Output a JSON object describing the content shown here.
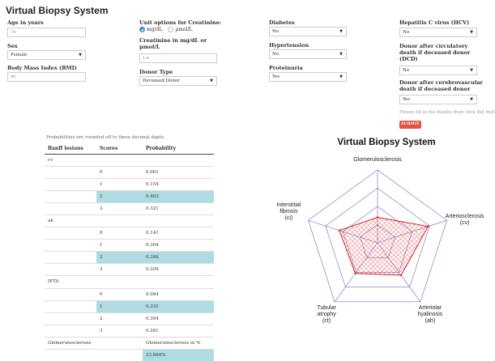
{
  "app": {
    "title": "Virtual Biopsy System"
  },
  "form": {
    "age": {
      "label": "Age in years",
      "value": "78"
    },
    "sex": {
      "label": "Sex",
      "value": "Female"
    },
    "bmi": {
      "label": "Body Mass Index (BMI)",
      "value": "40"
    },
    "creatinine_units": {
      "label": "Unit options for Creatinine:",
      "options": [
        "mg/dL",
        "µmol/L"
      ],
      "selected": "mg/dL"
    },
    "creatinine": {
      "label": "Creatinine in mg/dL or µmol/L",
      "value": "1.4"
    },
    "donor_type": {
      "label": "Donor Type",
      "value": "Deceased Donor"
    },
    "diabetes": {
      "label": "Diabetes",
      "value": "No"
    },
    "hypertension": {
      "label": "Hypertension",
      "value": "No"
    },
    "proteinuria": {
      "label": "Proteinuria",
      "value": "Yes"
    },
    "hcv": {
      "label": "Hepatitis C virus (HCV)",
      "value": "No"
    },
    "dcd": {
      "label": "Donor after circulatory death if deceased donor (DCD)",
      "value": "No"
    },
    "cerebro": {
      "label": "Donor after cerebrovascular death if deceased donor",
      "value": "Yes"
    },
    "hint": "Please fill in the blanks then click the butto",
    "submit_label": "SUBMIT"
  },
  "table": {
    "note": "Probabilities are rounded off to three decimal digits.",
    "headers": [
      "Banff lesions",
      "Scores",
      "Probability"
    ],
    "rows": [
      {
        "lesion": "cv",
        "score": "",
        "prob": "",
        "hl": false
      },
      {
        "lesion": "",
        "score": "0",
        "prob": "0.061",
        "hl": false
      },
      {
        "lesion": "",
        "score": "1",
        "prob": "0.154",
        "hl": false
      },
      {
        "lesion": "",
        "score": "2",
        "prob": "0.463",
        "hl": true
      },
      {
        "lesion": "",
        "score": "3",
        "prob": "0.321",
        "hl": false
      },
      {
        "lesion": "ah",
        "score": "",
        "prob": "",
        "hl": false
      },
      {
        "lesion": "",
        "score": "0",
        "prob": "0.141",
        "hl": false
      },
      {
        "lesion": "",
        "score": "1",
        "prob": "0.304",
        "hl": false
      },
      {
        "lesion": "",
        "score": "2",
        "prob": "0.346",
        "hl": true
      },
      {
        "lesion": "",
        "score": "3",
        "prob": "0.209",
        "hl": false
      },
      {
        "lesion": "IFTA",
        "score": "",
        "prob": "",
        "hl": false
      },
      {
        "lesion": "",
        "score": "0",
        "prob": "0.084",
        "hl": false
      },
      {
        "lesion": "",
        "score": "1",
        "prob": "0.331",
        "hl": true
      },
      {
        "lesion": "",
        "score": "2",
        "prob": "0.304",
        "hl": false
      },
      {
        "lesion": "",
        "score": "3",
        "prob": "0.281",
        "hl": false
      },
      {
        "lesion": "Glomerulosclerosis",
        "score": "",
        "prob": "Glomerulosclerosis in %",
        "hl": false
      },
      {
        "lesion": "",
        "score": "",
        "prob": "23.664%",
        "hl": "prob"
      }
    ]
  },
  "radar": {
    "title": "Virtual Biopsy System",
    "axes": [
      [
        "Glomerulosclerosis"
      ],
      [
        "Arteriosclerosis",
        "(cv)"
      ],
      [
        "Arteriolar",
        "hyalinosis",
        "(ah)"
      ],
      [
        "Tubular",
        "atrophy",
        "(ct)"
      ],
      [
        "Interstitial",
        "fibrosis",
        "(ci)"
      ]
    ],
    "levels": 4,
    "values": [
      0.35,
      0.73,
      0.55,
      0.52,
      0.55
    ],
    "colors": {
      "grid": "#6e6ec8",
      "series": "#e02020",
      "highlight": "#aedce2",
      "accent": "#3d8bd6",
      "submit": "#e0534b"
    }
  }
}
